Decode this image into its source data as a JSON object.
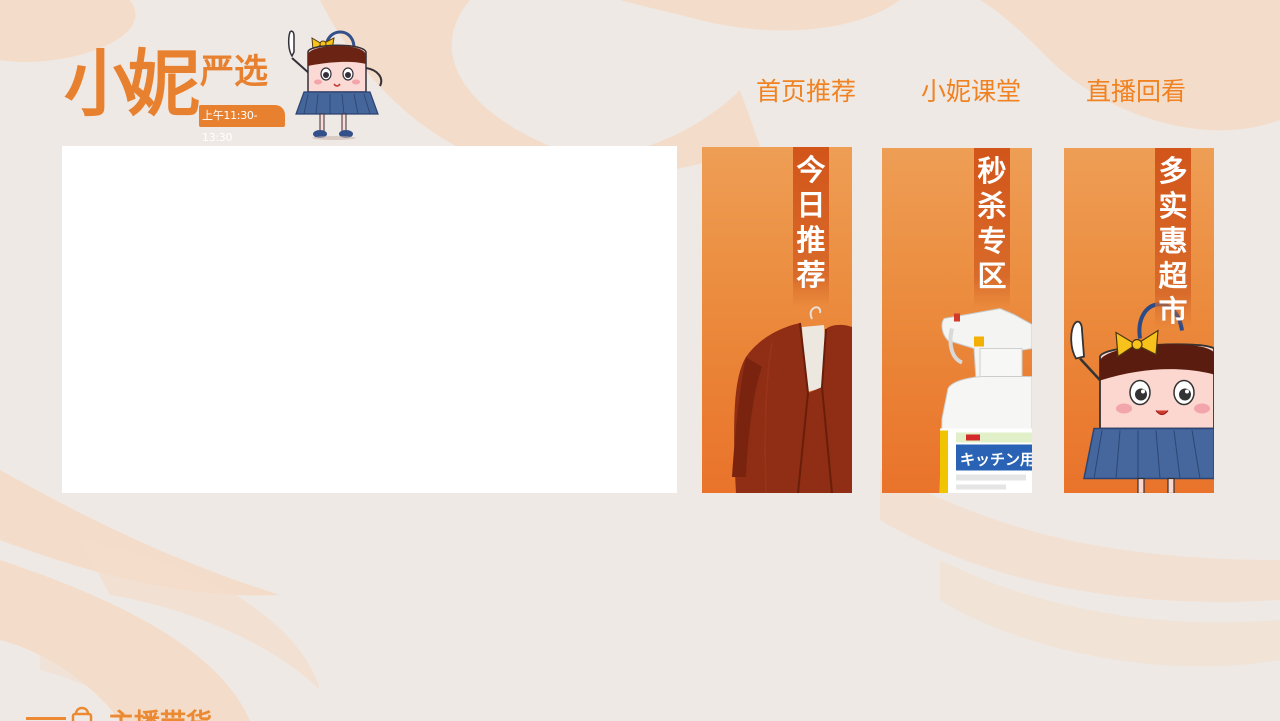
{
  "logo": {
    "name_primary": "小妮",
    "name_secondary": "严选",
    "live_time": "上午11:30-13:30"
  },
  "nav": {
    "items": [
      {
        "label": "首页推荐"
      },
      {
        "label": "小妮课堂"
      },
      {
        "label": "直播回看"
      }
    ]
  },
  "cards": [
    {
      "label": "今日推荐",
      "art": "red-coat-image"
    },
    {
      "label": "秒杀专区",
      "art": "spray-bottle-image"
    },
    {
      "label": "多实惠超市",
      "art": "mascot-pointing-image"
    }
  ],
  "product_text": {
    "spray_brand": "キッチン用"
  },
  "section": {
    "title": "主播带货"
  },
  "colors": {
    "accent": "#f08221",
    "card_top": "#ee9e55",
    "card_bottom": "#e9732a",
    "label_band": "#d2551a",
    "background": "#efe9e5",
    "wave": "#f2dcc8"
  }
}
